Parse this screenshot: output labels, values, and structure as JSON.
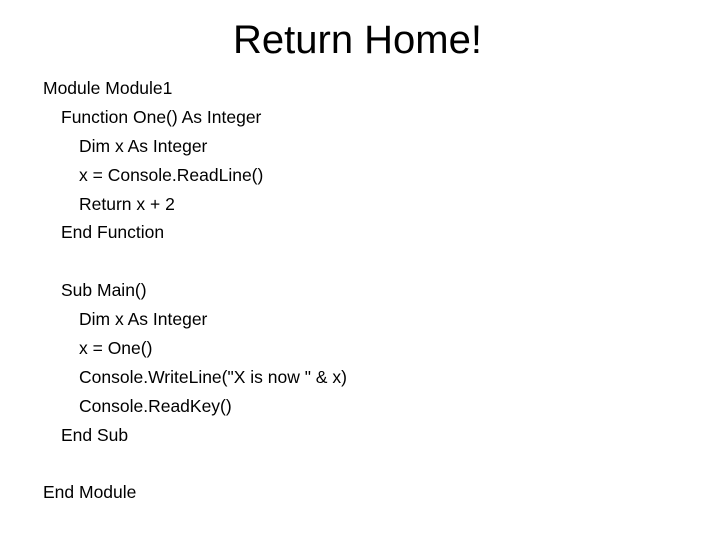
{
  "slide": {
    "title": "Return Home!",
    "code_lines": [
      {
        "text": "Module Module1",
        "indent": 0
      },
      {
        "text": "Function One() As Integer",
        "indent": 1
      },
      {
        "text": "Dim x As Integer",
        "indent": 2
      },
      {
        "text": "x = Console.ReadLine()",
        "indent": 2
      },
      {
        "text": "Return x + 2",
        "indent": 2
      },
      {
        "text": "End Function",
        "indent": 1
      },
      {
        "text": "",
        "indent": 0
      },
      {
        "text": "Sub Main()",
        "indent": 1
      },
      {
        "text": "Dim x As Integer",
        "indent": 2
      },
      {
        "text": "x = One()",
        "indent": 2
      },
      {
        "text": "Console.WriteLine(\"X is now \" & x)",
        "indent": 2
      },
      {
        "text": "Console.ReadKey()",
        "indent": 2
      },
      {
        "text": "End Sub",
        "indent": 1
      },
      {
        "text": "",
        "indent": 0
      },
      {
        "text": "End Module",
        "indent": 0
      }
    ]
  }
}
